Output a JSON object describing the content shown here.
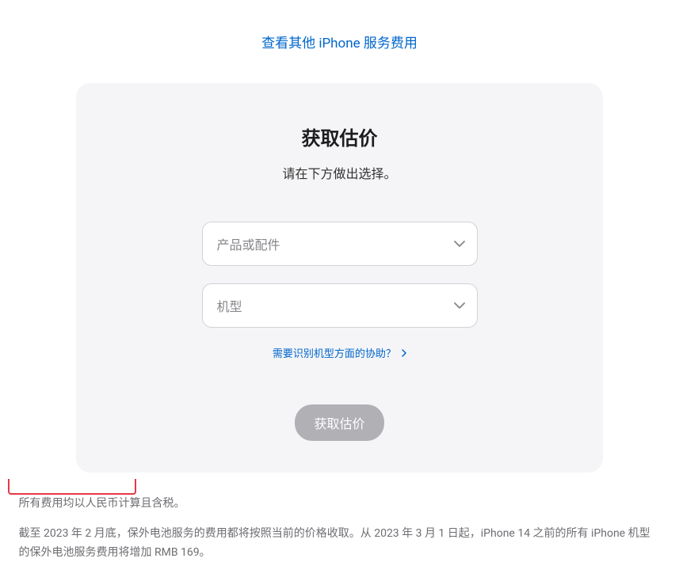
{
  "topLink": {
    "text": "查看其他 iPhone 服务费用"
  },
  "card": {
    "title": "获取估价",
    "subtitle": "请在下方做出选择。",
    "selectProduct": {
      "placeholder": "产品或配件"
    },
    "selectModel": {
      "placeholder": "机型"
    },
    "helpLink": {
      "text": "需要识别机型方面的协助？"
    },
    "submitButton": {
      "label": "获取估价"
    }
  },
  "footer": {
    "line1": "所有费用均以人民币计算且含税。",
    "line2_part1": "截至 2023 年 2 月底，保外电池服务的费用都将按照当前的价格收取。从 2023 年 3 月 1 日起，iPhone 14 之前的所有 iPhone 机型的保外电池服务",
    "line2_part2": "费用将增加 RMB 169。"
  }
}
